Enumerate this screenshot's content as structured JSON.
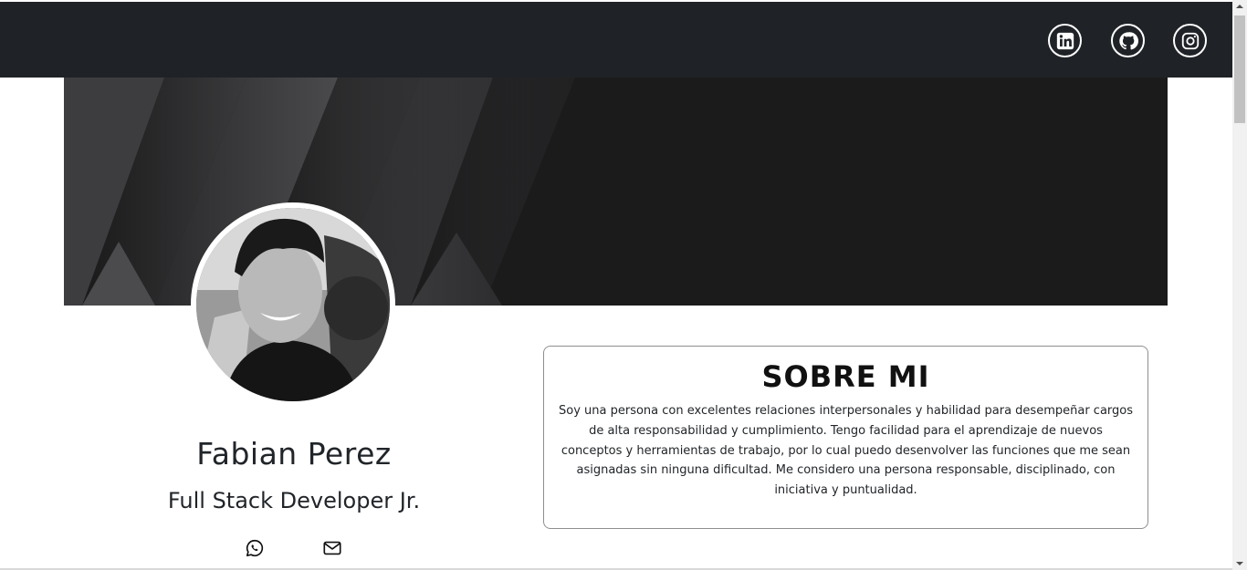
{
  "header": {
    "social": [
      {
        "name": "linkedin-icon"
      },
      {
        "name": "github-icon"
      },
      {
        "name": "instagram-icon"
      }
    ]
  },
  "profile": {
    "name": "Fabian Perez",
    "role": "Full Stack Developer Jr.",
    "contacts": [
      {
        "icon": "whatsapp-icon"
      },
      {
        "icon": "mail-icon"
      }
    ]
  },
  "about": {
    "title": "SOBRE MI",
    "text": "Soy una persona con excelentes relaciones interpersonales y habilidad para desempeñar cargos de alta responsabilidad y cumplimiento. Tengo facilidad para el aprendizaje de nuevos conceptos y herramientas de trabajo, por lo cual puedo desenvolver las funciones que me sean asignadas sin ninguna dificultad. Me considero una persona responsable, disciplinado, con iniciativa y puntualidad."
  },
  "colors": {
    "header_bg": "#1f2226",
    "text": "#212529",
    "card_border": "#8f8f8f"
  }
}
